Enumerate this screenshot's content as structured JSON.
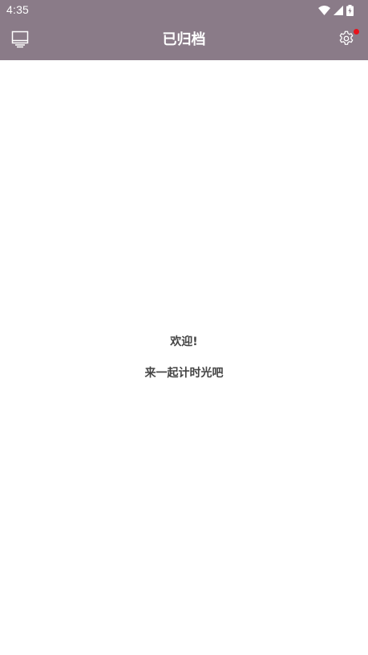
{
  "status_bar": {
    "time": "4:35",
    "icons": [
      "wifi-icon",
      "cellular-signal-icon",
      "battery-icon"
    ]
  },
  "app_bar": {
    "title": "已归档",
    "left_icon": "monitor-icon",
    "right_icon": "gear-icon",
    "background_color": "#8a7b88",
    "notification_dot_color": "#e8121b"
  },
  "empty_state": {
    "welcome": "欢迎!",
    "message": "来一起计时光吧"
  }
}
